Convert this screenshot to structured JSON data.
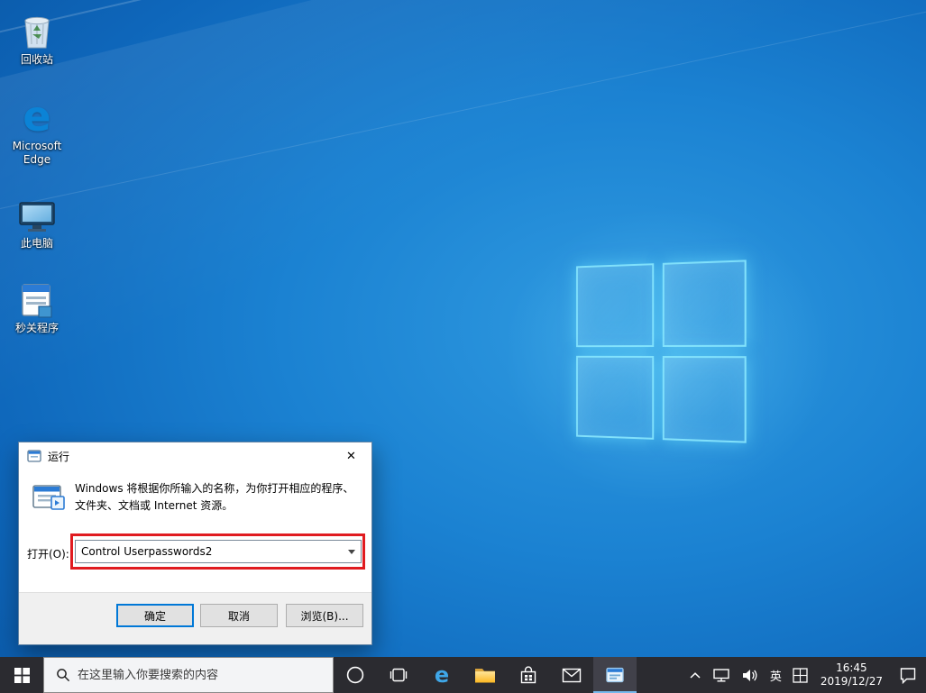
{
  "colors": {
    "accent": "#0078d7",
    "annotation_red": "#e01b20",
    "taskbar_bg": "#2b2b30",
    "wallpaper_blue": "#0e66ba"
  },
  "desktop": {
    "icons": [
      {
        "label": "回收站"
      },
      {
        "label": "Microsoft Edge"
      },
      {
        "label": "此电脑"
      },
      {
        "label": "秒关程序"
      }
    ],
    "edge_glyph": "e"
  },
  "run_dialog": {
    "title": "运行",
    "close_glyph": "✕",
    "description": "Windows 将根据你所输入的名称，为你打开相应的程序、文件夹、文档或 Internet 资源。",
    "open_label": "打开(O):",
    "input_value": "Control Userpasswords2",
    "ok_label": "确定",
    "cancel_label": "取消",
    "browse_label": "浏览(B)..."
  },
  "taskbar": {
    "search_placeholder": "在这里输入你要搜索的内容",
    "edge_glyph": "e",
    "tray": {
      "ime_label": "英",
      "time": "16:45",
      "date": "2019/12/27"
    }
  }
}
